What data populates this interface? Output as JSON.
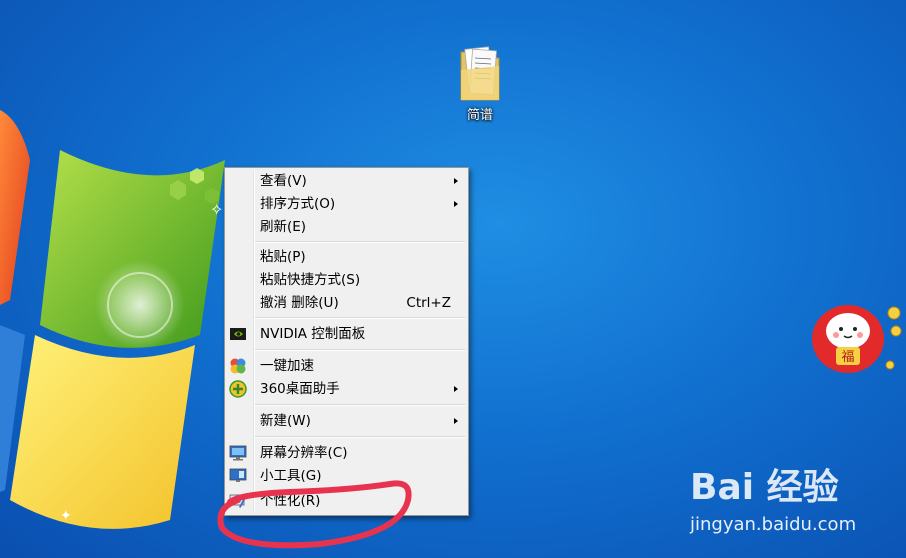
{
  "desktop": {
    "icon_label": "简谱"
  },
  "context_menu": {
    "items": [
      {
        "label": "查看(V)",
        "submenu": true
      },
      {
        "label": "排序方式(O)",
        "submenu": true
      },
      {
        "label": "刷新(E)"
      },
      {
        "label": "粘贴(P)"
      },
      {
        "label": "粘贴快捷方式(S)"
      },
      {
        "label": "撤消 删除(U)",
        "shortcut": "Ctrl+Z"
      },
      {
        "label": "NVIDIA 控制面板",
        "icon": "nvidia-icon"
      },
      {
        "label": "一键加速",
        "icon": "speedup-icon"
      },
      {
        "label": "360桌面助手",
        "icon": "360-icon",
        "submenu": true
      },
      {
        "label": "新建(W)",
        "submenu": true
      },
      {
        "label": "屏幕分辨率(C)",
        "icon": "monitor-icon"
      },
      {
        "label": "小工具(G)",
        "icon": "gadgets-icon"
      },
      {
        "label": "个性化(R)",
        "icon": "personalize-icon"
      }
    ]
  },
  "watermark": {
    "logo_text": "Bai 经验",
    "url": "jingyan.baidu.com"
  },
  "sticker": {
    "text": "福"
  },
  "colors": {
    "desktop_blue": "#1170cf",
    "menu_bg": "#f0f0f0",
    "scribble": "#e8334f"
  }
}
